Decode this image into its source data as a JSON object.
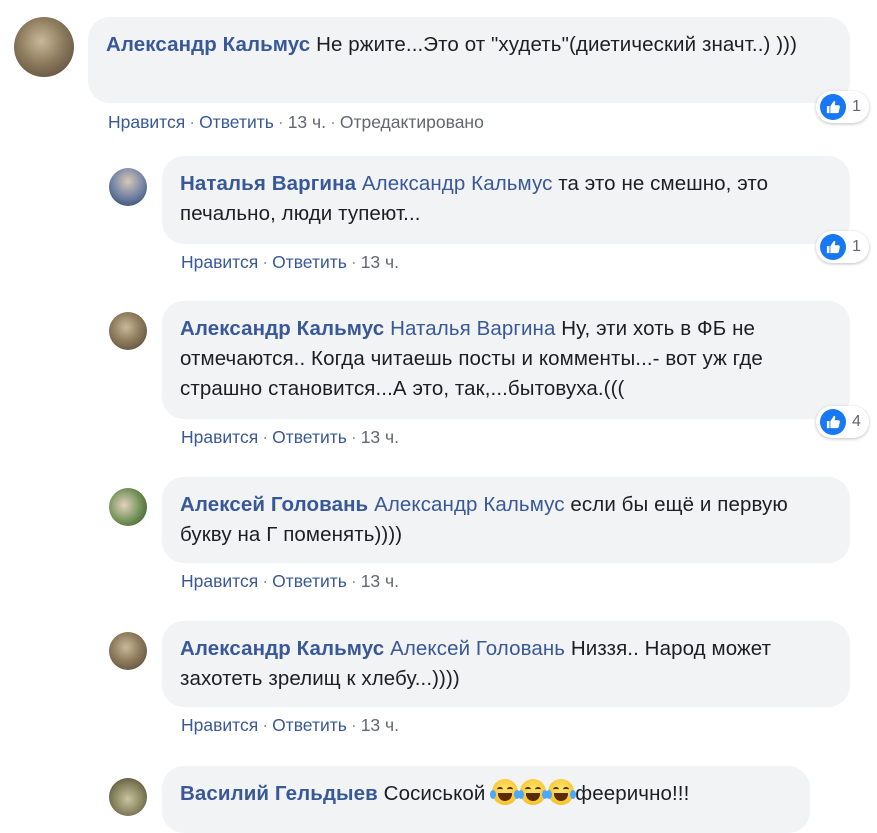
{
  "comments": [
    {
      "author": "Александр Кальмус",
      "mention": "",
      "text": "Не ржите...Это от \"худеть\"(диетический значт..) )))",
      "actions": {
        "like": "Нравится",
        "reply": "Ответить",
        "time": "13 ч.",
        "edited": "Отредактировано"
      },
      "reactions": "1"
    },
    {
      "author": "Наталья Варгина",
      "mention": "Александр Кальмус",
      "text": "та это не смешно, это печально, люди тупеют...",
      "actions": {
        "like": "Нравится",
        "reply": "Ответить",
        "time": "13 ч."
      },
      "reactions": "1"
    },
    {
      "author": "Александр Кальмус",
      "mention": "Наталья Варгина",
      "text": "Ну, эти хоть в ФБ не отмечаются.. Когда читаешь посты и комменты...- вот уж где страшно становится...А это, так,...бытовуха.(((",
      "actions": {
        "like": "Нравится",
        "reply": "Ответить",
        "time": "13 ч."
      },
      "reactions": "4"
    },
    {
      "author": "Алексей Головань",
      "mention": "Александр Кальмус",
      "text": "если бы ещё и первую букву на Г поменять))))",
      "actions": {
        "like": "Нравится",
        "reply": "Ответить",
        "time": "13 ч."
      },
      "reactions": ""
    },
    {
      "author": "Александр Кальмус",
      "mention": "Алексей Головань",
      "text": "Низзя.. Народ может захотеть зрелищ к хлебу...))))",
      "actions": {
        "like": "Нравится",
        "reply": "Ответить",
        "time": "13 ч."
      },
      "reactions": ""
    },
    {
      "author": "Василий Гельдыев",
      "mention": "",
      "text_before": "Сосиськой",
      "emoji": "face-with-tears-of-joy-icon",
      "text_after": "феерично!!!",
      "reactions": ""
    }
  ],
  "icons": {
    "like": "like-thumb-icon"
  },
  "colors": {
    "link": "#385898",
    "bubble": "#f2f3f5",
    "like_blue": "#1877f2",
    "meta": "#616770"
  }
}
